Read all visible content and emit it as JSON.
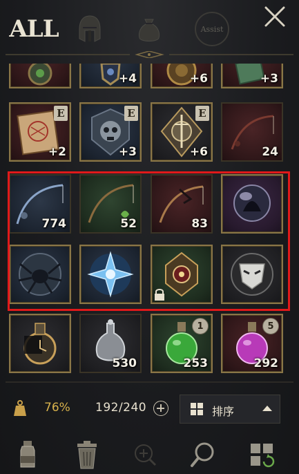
{
  "tabs": {
    "all_label": "ALL",
    "helmet_icon": "helmet-icon",
    "bag_icon": "money-bag-icon",
    "assist_label": "Assist"
  },
  "close_icon": "close-icon",
  "rows": [
    [
      {
        "icon": "emblem-green",
        "count": ""
      },
      {
        "icon": "emblem-shield",
        "count": "+4"
      },
      {
        "icon": "emblem-gold",
        "count": "+6"
      },
      {
        "icon": "rune-tablet",
        "count": "+3"
      }
    ],
    [
      {
        "icon": "spell-book",
        "count": "+2",
        "badge": "E"
      },
      {
        "icon": "skull-crest",
        "count": "+3",
        "badge": "E"
      },
      {
        "icon": "sword-crest",
        "count": "+6",
        "badge": "E"
      },
      {
        "icon": "fishing-rod-red",
        "count": "24"
      }
    ],
    [
      {
        "icon": "fishing-rod-dark",
        "count": "774"
      },
      {
        "icon": "fishing-rod-green",
        "count": "52"
      },
      {
        "icon": "fishing-rod-red-dark",
        "count": "83"
      },
      {
        "icon": "dark-orb",
        "count": ""
      }
    ],
    [
      {
        "icon": "spider-crest",
        "count": ""
      },
      {
        "icon": "ice-crystal",
        "count": ""
      },
      {
        "icon": "ornate-relic",
        "count": "",
        "locked": true
      },
      {
        "icon": "mask-crest",
        "count": ""
      }
    ],
    [
      {
        "icon": "clock-flask",
        "count": ""
      },
      {
        "icon": "silver-flask",
        "count": "530"
      },
      {
        "icon": "green-potion",
        "count": "253",
        "num_badge": "1"
      },
      {
        "icon": "purple-potion",
        "count": "292",
        "num_badge": "5"
      }
    ]
  ],
  "status": {
    "weight_icon": "weight-icon",
    "weight_percent": "76%",
    "capacity": "192/240",
    "expand_icon": "plus-circle-icon",
    "sort_label": "排序",
    "sort_icon": "grid-icon",
    "caret_icon": "caret-up-icon"
  },
  "toolbar": {
    "items": [
      "potion-bottle-icon",
      "trash-can-icon",
      "zoom-in-icon",
      "magnifier-icon",
      "grid-recycle-icon"
    ]
  },
  "colors": {
    "highlight": "#e0191a",
    "weight_percent": "#d8b24c",
    "text": "#e8e1cf"
  }
}
